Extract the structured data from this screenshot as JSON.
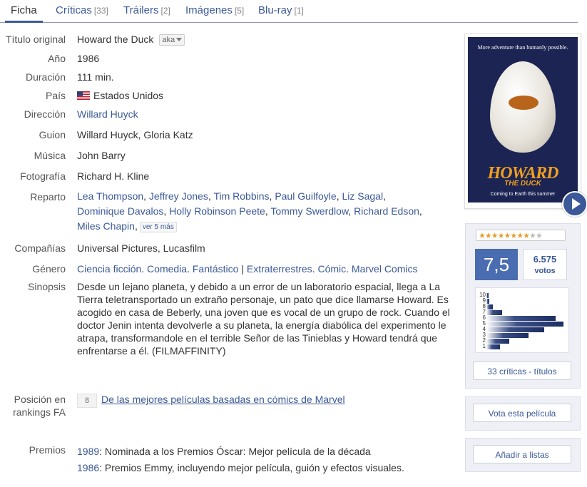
{
  "tabs": [
    {
      "label": "Ficha",
      "count": ""
    },
    {
      "label": "Críticas",
      "count": "[33]"
    },
    {
      "label": "Tráilers",
      "count": "[2]"
    },
    {
      "label": "Imágenes",
      "count": "[5]"
    },
    {
      "label": "Blu-ray",
      "count": "[1]"
    }
  ],
  "labels": {
    "titulo": "Título original",
    "anio": "Año",
    "duracion": "Duración",
    "pais": "País",
    "direccion": "Dirección",
    "guion": "Guion",
    "musica": "Música",
    "fotografia": "Fotografía",
    "reparto": "Reparto",
    "companias": "Compañías",
    "genero": "Género",
    "sinopsis": "Sinopsis",
    "posicion": "Posición en rankings FA",
    "premios": "Premios"
  },
  "film": {
    "title": "Howard the Duck",
    "aka": "aka",
    "year": "1986",
    "duration": "111 min.",
    "country": "Estados Unidos",
    "director": "Willard Huyck",
    "writers": "Willard Huyck, Gloria Katz",
    "music": "John Barry",
    "photography": "Richard H. Kline",
    "cast": [
      "Lea Thompson",
      "Jeffrey Jones",
      "Tim Robbins",
      "Paul Guilfoyle",
      "Liz Sagal",
      "Dominique Davalos",
      "Holly Robinson Peete",
      "Tommy Swerdlow",
      "Richard Edson",
      "Miles Chapin"
    ],
    "cast_more": "ver 5 más",
    "companies": "Universal Pictures, Lucasfilm",
    "genres": [
      "Ciencia ficción",
      "Comedia",
      "Fantástico",
      "Extraterrestres",
      "Cómic",
      "Marvel Comics"
    ],
    "synopsis": "Desde un lejano planeta, y debido a un error de un laboratorio espacial, llega a La Tierra teletransportado un extraño personaje, un pato que dice llamarse Howard. Es acogido en casa de Beberly, una joven que es vocal de un grupo de rock. Cuando el doctor Jenin intenta devolverle a su planeta, la energía diabólica del experimento le atrapa, transformandole en el terrible Señor de las Tinieblas y Howard tendrá que enfrentarse a él. (FILMAFFINITY)",
    "ranking_position": "8",
    "ranking_link": "De las mejores películas basadas en cómics de Marvel",
    "awards": [
      {
        "year": "1989",
        "text": ": Nominada a los Premios Óscar: Mejor película de la década"
      },
      {
        "year": "1986",
        "text": ": Premios Emmy, incluyendo mejor película, guión y efectos visuales."
      }
    ]
  },
  "poster": {
    "tagline": "More adventure than humanly possible.",
    "title": "HOWARD",
    "subtitle": "THE DUCK",
    "coming": "Coming to Earth this summer"
  },
  "rating": {
    "stars_filled": 7.5,
    "stars_total": 10,
    "score": "7,5",
    "votes": "6.575",
    "votes_label": "votos",
    "histogram": [
      {
        "label": "10",
        "value": 0.03
      },
      {
        "label": "9",
        "value": 0.04
      },
      {
        "label": "8",
        "value": 0.08
      },
      {
        "label": "7",
        "value": 0.2
      },
      {
        "label": "6",
        "value": 0.9
      },
      {
        "label": "5",
        "value": 1.0
      },
      {
        "label": "4",
        "value": 0.75
      },
      {
        "label": "3",
        "value": 0.55
      },
      {
        "label": "2",
        "value": 0.3
      },
      {
        "label": "1",
        "value": 0.18
      }
    ],
    "reviews_button": "33 críticas - títulos"
  },
  "actions": {
    "vote": "Vota esta película",
    "add_list": "Añadir a listas"
  },
  "colors": {
    "accent": "#3b5998",
    "score_bg": "#4a6cb0"
  }
}
